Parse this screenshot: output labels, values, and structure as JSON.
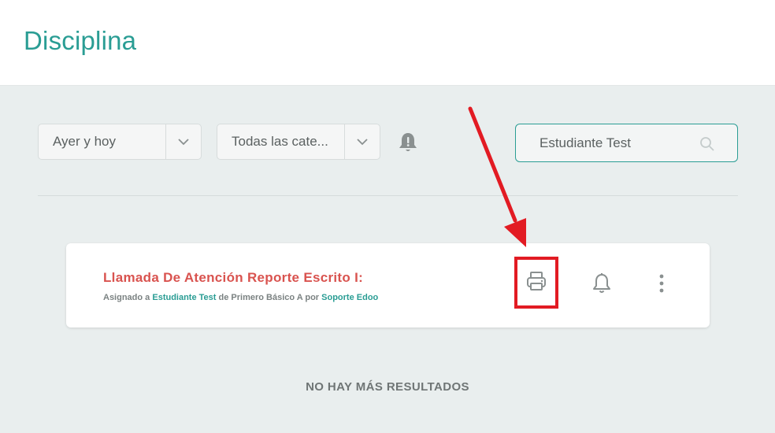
{
  "header": {
    "title": "Disciplina"
  },
  "filters": {
    "date_range": {
      "value": "Ayer y hoy"
    },
    "category": {
      "value": "Todas las cate..."
    }
  },
  "search": {
    "value": "Estudiante Test"
  },
  "card": {
    "title": "Llamada De Atención Reporte Escrito I:",
    "meta": {
      "prefix": "Asignado a",
      "student": "Estudiante Test",
      "middle": "de Primero Básico A",
      "by": "por",
      "author": "Soporte Edoo"
    }
  },
  "footer": {
    "no_more": "NO HAY MÁS RESULTADOS"
  },
  "icons": {
    "date_chevron": "chevron-down-icon",
    "category_chevron": "chevron-down-icon",
    "filter_alert": "bell-alert-icon",
    "search": "search-icon",
    "print": "printer-icon",
    "notify": "bell-icon",
    "more": "more-vertical-icon"
  },
  "colors": {
    "accent": "#2a9d94",
    "title_red": "#d9534f",
    "annotation_red": "#e21b23"
  }
}
